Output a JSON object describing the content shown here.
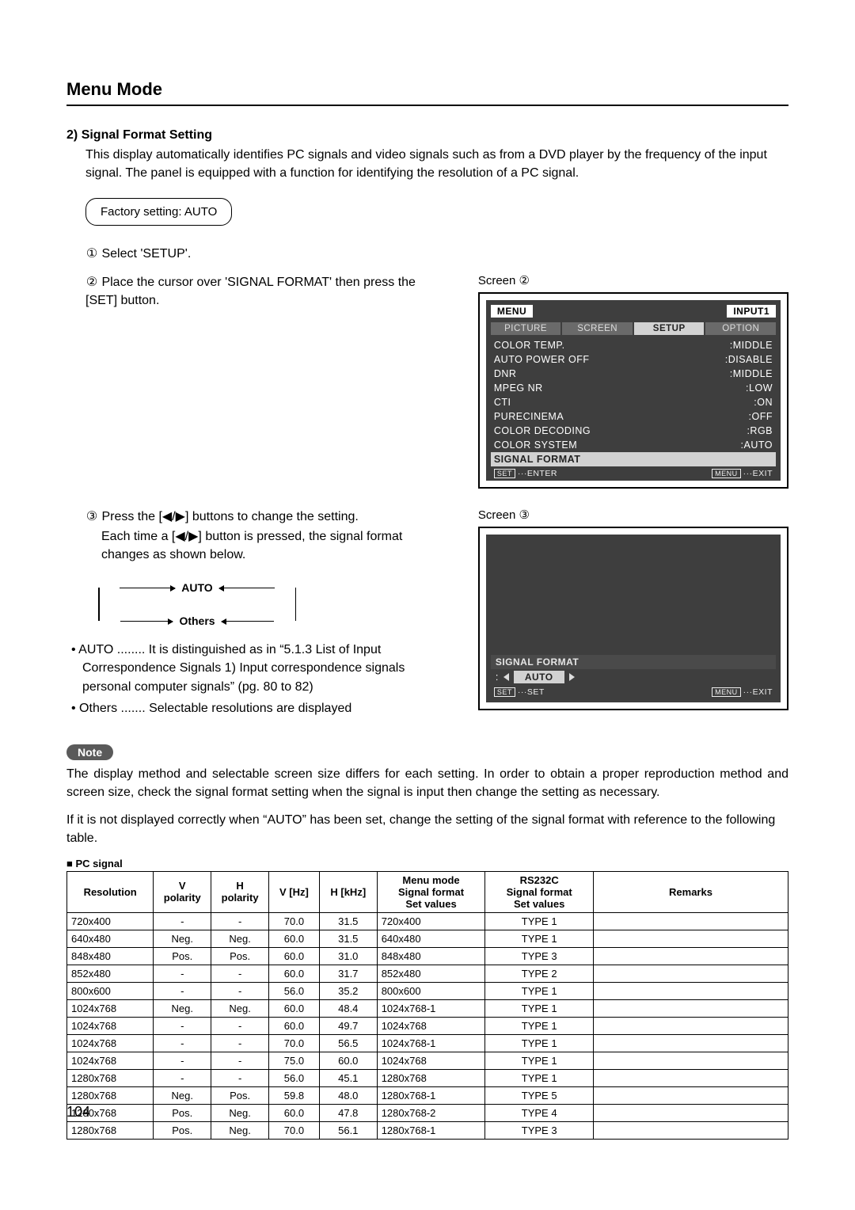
{
  "title": "Menu Mode",
  "section": {
    "num": "2)",
    "heading": "Signal Format Setting",
    "intro": "This display automatically identifies PC signals and video signals such as from a DVD player by the frequency of the input signal. The panel is equipped with a function for identifying the resolution of a PC signal.",
    "factory": "Factory setting: AUTO",
    "step1": "Select 'SETUP'.",
    "step2": "Place the cursor over 'SIGNAL FORMAT' then press the [SET] button.",
    "step3a": "Press the [◀/▶] buttons to change the setting.",
    "step3b": "Each time a [◀/▶] button is pressed, the signal format changes as shown below.",
    "cycle": {
      "a": "AUTO",
      "b": "Others"
    },
    "auto_label": "AUTO",
    "auto_desc": "........ It is distinguished as in “5.1.3 List of Input Correspondence Signals 1) Input correspondence signals personal computer signals” (pg. 80 to 82)",
    "others_label": "Others",
    "others_desc": "....... Selectable resolutions are displayed"
  },
  "screen2": {
    "label": "Screen ②",
    "menu": "MENU",
    "input": "INPUT1",
    "tabs": [
      "PICTURE",
      "SCREEN",
      "SETUP",
      "OPTION"
    ],
    "active_tab": 2,
    "rows": [
      {
        "k": "COLOR TEMP.",
        "v": ":MIDDLE"
      },
      {
        "k": "AUTO POWER OFF",
        "v": ":DISABLE"
      },
      {
        "k": "DNR",
        "v": ":MIDDLE"
      },
      {
        "k": "MPEG NR",
        "v": ":LOW"
      },
      {
        "k": "CTI",
        "v": ":ON"
      },
      {
        "k": "PURECINEMA",
        "v": ":OFF"
      },
      {
        "k": "COLOR DECODING",
        "v": ":RGB"
      },
      {
        "k": "COLOR SYSTEM",
        "v": ":AUTO"
      }
    ],
    "highlight": "SIGNAL FORMAT",
    "foot_l": "SET ···ENTER",
    "foot_r": "MENU ···EXIT"
  },
  "screen3": {
    "label": "Screen ③",
    "name": "SIGNAL FORMAT",
    "colon": ":",
    "value": "AUTO",
    "foot_l": "SET ···SET",
    "foot_r": "MENU ···EXIT"
  },
  "note": {
    "label": "Note",
    "p1": "The display method and selectable screen size differs for each setting. In order to obtain a proper reproduction method and screen size, check the signal format setting when the signal is input then change the setting as necessary.",
    "p2": "If it is not displayed correctly when “AUTO” has been set, change the setting of the signal format with reference to the following table."
  },
  "table": {
    "title": "■ PC signal",
    "headers": {
      "res": "Resolution",
      "vp": "V\npolarity",
      "hp": "H\npolarity",
      "vhz": "V [Hz]",
      "hkhz": "H [kHz]",
      "menu": "Menu mode\nSignal format\nSet values",
      "rs": "RS232C\nSignal format\nSet values",
      "rem": "Remarks"
    },
    "rows": [
      {
        "res": "720x400",
        "vp": "-",
        "hp": "-",
        "vhz": "70.0",
        "hkhz": "31.5",
        "menu": "720x400",
        "rs": "TYPE 1",
        "rem": ""
      },
      {
        "res": "640x480",
        "vp": "Neg.",
        "hp": "Neg.",
        "vhz": "60.0",
        "hkhz": "31.5",
        "menu": "640x480",
        "rs": "TYPE 1",
        "rem": ""
      },
      {
        "res": "848x480",
        "vp": "Pos.",
        "hp": "Pos.",
        "vhz": "60.0",
        "hkhz": "31.0",
        "menu": "848x480",
        "rs": "TYPE 3",
        "rem": ""
      },
      {
        "res": "852x480",
        "vp": "-",
        "hp": "-",
        "vhz": "60.0",
        "hkhz": "31.7",
        "menu": "852x480",
        "rs": "TYPE 2",
        "rem": ""
      },
      {
        "res": "800x600",
        "vp": "-",
        "hp": "-",
        "vhz": "56.0",
        "hkhz": "35.2",
        "menu": "800x600",
        "rs": "TYPE 1",
        "rem": ""
      },
      {
        "res": "1024x768",
        "vp": "Neg.",
        "hp": "Neg.",
        "vhz": "60.0",
        "hkhz": "48.4",
        "menu": "1024x768-1",
        "rs": "TYPE 1",
        "rem": ""
      },
      {
        "res": "1024x768",
        "vp": "-",
        "hp": "-",
        "vhz": "60.0",
        "hkhz": "49.7",
        "menu": "1024x768",
        "rs": "TYPE 1",
        "rem": ""
      },
      {
        "res": "1024x768",
        "vp": "-",
        "hp": "-",
        "vhz": "70.0",
        "hkhz": "56.5",
        "menu": "1024x768-1",
        "rs": "TYPE 1",
        "rem": ""
      },
      {
        "res": "1024x768",
        "vp": "-",
        "hp": "-",
        "vhz": "75.0",
        "hkhz": "60.0",
        "menu": "1024x768",
        "rs": "TYPE 1",
        "rem": ""
      },
      {
        "res": "1280x768",
        "vp": "-",
        "hp": "-",
        "vhz": "56.0",
        "hkhz": "45.1",
        "menu": "1280x768",
        "rs": "TYPE 1",
        "rem": ""
      },
      {
        "res": "1280x768",
        "vp": "Neg.",
        "hp": "Pos.",
        "vhz": "59.8",
        "hkhz": "48.0",
        "menu": "1280x768-1",
        "rs": "TYPE 5",
        "rem": ""
      },
      {
        "res": "1280x768",
        "vp": "Pos.",
        "hp": "Neg.",
        "vhz": "60.0",
        "hkhz": "47.8",
        "menu": "1280x768-2",
        "rs": "TYPE 4",
        "rem": ""
      },
      {
        "res": "1280x768",
        "vp": "Pos.",
        "hp": "Neg.",
        "vhz": "70.0",
        "hkhz": "56.1",
        "menu": "1280x768-1",
        "rs": "TYPE 3",
        "rem": ""
      }
    ]
  },
  "page_num": "104",
  "glyphs": {
    "c1": "①",
    "c2": "②",
    "c3": "③"
  }
}
